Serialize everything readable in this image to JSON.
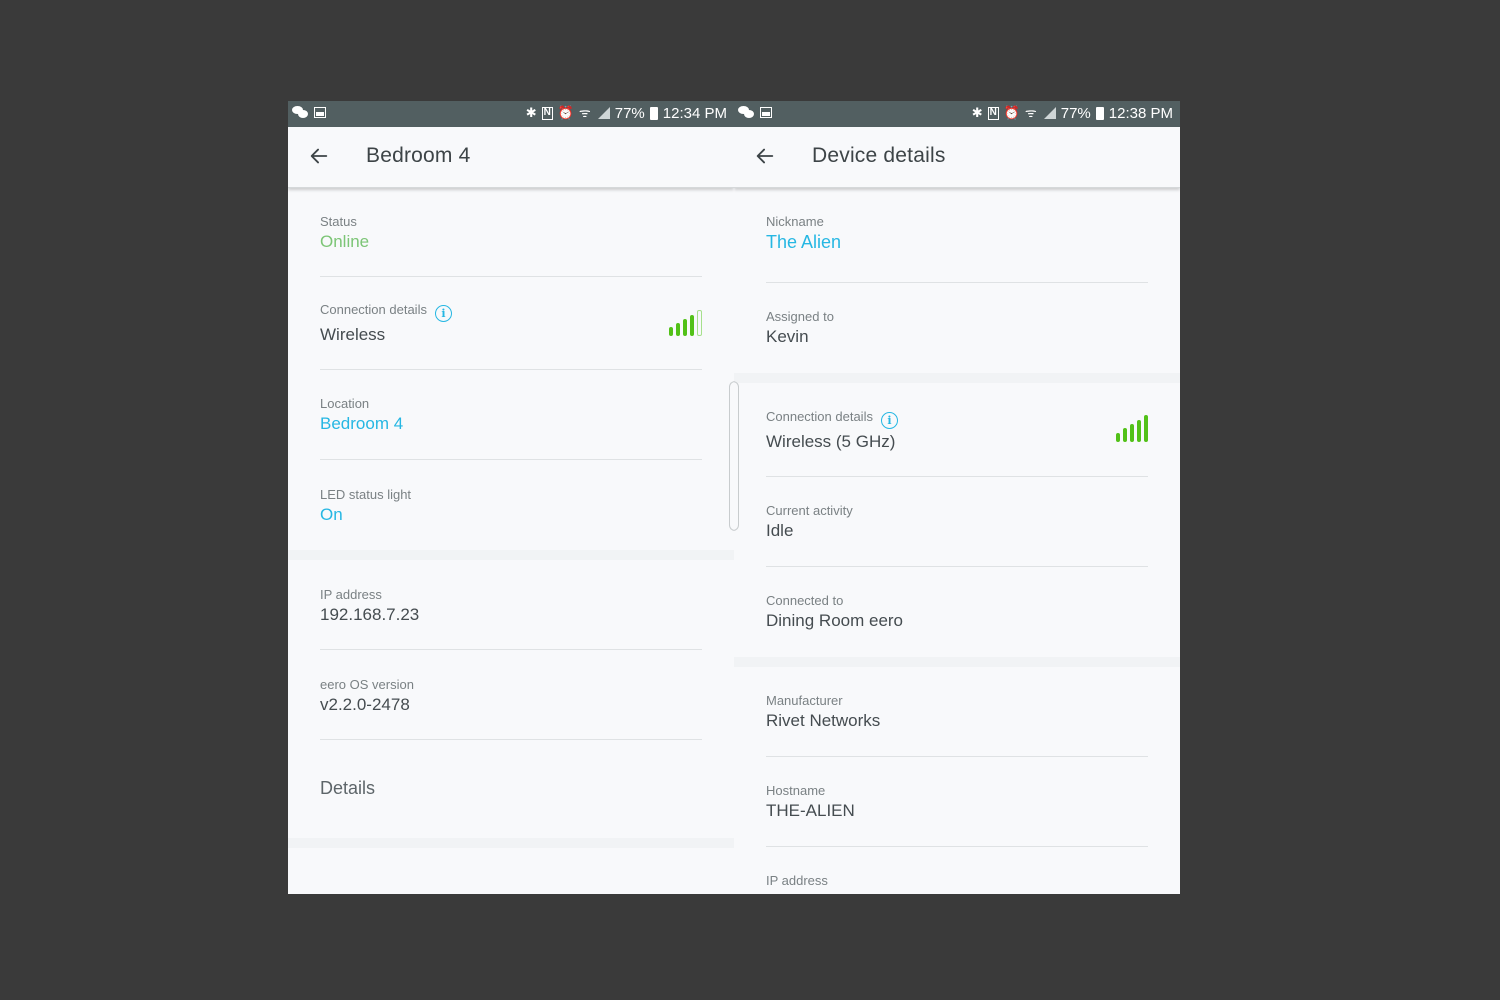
{
  "left_screen": {
    "statusbar": {
      "left_icons": [
        "chat-icon",
        "gallery-icon"
      ],
      "right_icons": [
        "bluetooth-icon",
        "nfc-icon",
        "alarm-icon",
        "wifi-icon",
        "cell-signal-icon",
        "battery-icon"
      ],
      "battery": "77%",
      "time": "12:34 PM"
    },
    "appbar": {
      "back_icon": "arrow-left-icon",
      "title": "Bedroom 4"
    },
    "rows": {
      "status": {
        "label": "Status",
        "value": "Online"
      },
      "connection": {
        "label": "Connection details",
        "value": "Wireless",
        "signal_bars_filled": 4,
        "signal_bars_total": 5
      },
      "location": {
        "label": "Location",
        "value": "Bedroom 4"
      },
      "led": {
        "label": "LED status light",
        "value": "On"
      },
      "ip": {
        "label": "IP address",
        "value": "192.168.7.23"
      },
      "os": {
        "label": "eero OS version",
        "value": "v2.2.0-2478"
      },
      "details": {
        "label": "Details"
      }
    }
  },
  "right_screen": {
    "statusbar": {
      "left_icons": [
        "chat-icon",
        "gallery-icon"
      ],
      "right_icons": [
        "bluetooth-icon",
        "nfc-icon",
        "alarm-icon",
        "wifi-icon",
        "cell-signal-icon",
        "battery-icon"
      ],
      "battery": "77%",
      "time": "12:38 PM"
    },
    "appbar": {
      "back_icon": "arrow-left-icon",
      "title": "Device details"
    },
    "rows": {
      "nickname": {
        "label": "Nickname",
        "value": "The Alien"
      },
      "assigned": {
        "label": "Assigned to",
        "value": "Kevin"
      },
      "connection": {
        "label": "Connection details",
        "value": "Wireless (5 GHz)",
        "signal_bars_filled": 5,
        "signal_bars_total": 5
      },
      "activity": {
        "label": "Current activity",
        "value": "Idle"
      },
      "connected_to": {
        "label": "Connected to",
        "value": "Dining Room eero"
      },
      "manufacturer": {
        "label": "Manufacturer",
        "value": "Rivet Networks"
      },
      "hostname": {
        "label": "Hostname",
        "value": "THE-ALIEN"
      },
      "ip": {
        "label": "IP address"
      }
    }
  },
  "colors": {
    "statusbar_bg": "#525f61",
    "online_green": "#7cc576",
    "link_blue": "#26b7e3",
    "signal_green": "#52c118",
    "backdrop": "#3a3a3a"
  }
}
